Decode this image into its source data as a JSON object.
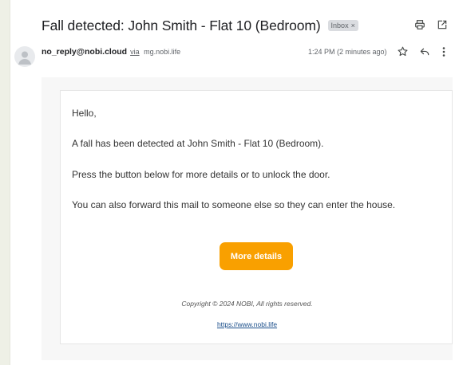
{
  "email": {
    "subject": "Fall detected: John Smith - Flat 10 (Bedroom)",
    "label_chip": "Inbox",
    "label_remove": "×",
    "sender": "no_reply@nobi.cloud",
    "via_text": "via",
    "via_domain": "mg.nobi.life",
    "time": "1:24 PM (2 minutes ago)"
  },
  "icons": {
    "print": "printer-icon",
    "popout": "open-in-new-window-icon",
    "avatar": "person-avatar-icon",
    "star": "star-icon",
    "reply": "reply-icon",
    "more": "more-vertical-icon"
  },
  "body": {
    "greeting": "Hello,",
    "line1": "A fall has been detected at John Smith - Flat 10 (Bedroom).",
    "line2": "Press the button below for more details or to unlock the door.",
    "line3": "You can also forward this mail to someone else so they can enter the house.",
    "button_label": "More details",
    "copyright": "Copyright © 2024 NOBI, All rights reserved.",
    "link_text": "https://www.nobi.life"
  },
  "colors": {
    "button": "#f9a000",
    "link": "#1a4e8a",
    "background": "#eef0e6"
  }
}
